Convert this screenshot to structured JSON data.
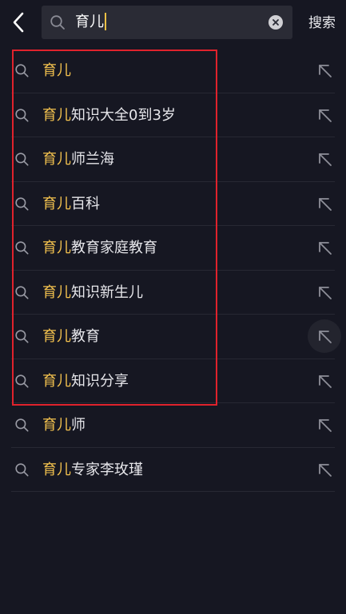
{
  "search": {
    "query": "育儿",
    "action_label": "搜索"
  },
  "suggestions": [
    {
      "highlight": "育儿",
      "rest": ""
    },
    {
      "highlight": "育儿",
      "rest": "知识大全0到3岁"
    },
    {
      "highlight": "育儿",
      "rest": "师兰海"
    },
    {
      "highlight": "育儿",
      "rest": "百科"
    },
    {
      "highlight": "育儿",
      "rest": "教育家庭教育"
    },
    {
      "highlight": "育儿",
      "rest": "知识新生儿"
    },
    {
      "highlight": "育儿",
      "rest": "教育"
    },
    {
      "highlight": "育儿",
      "rest": "知识分享"
    },
    {
      "highlight": "育儿",
      "rest": "师"
    },
    {
      "highlight": "育儿",
      "rest": "专家李玫瑾"
    }
  ],
  "icons": {
    "back": "chevron-left-icon",
    "search": "search-icon",
    "clear": "clear-icon",
    "fill": "arrow-up-left-icon"
  },
  "colors": {
    "background": "#161722",
    "highlight": "#f2c14e",
    "annotation_frame": "#e0222c"
  }
}
